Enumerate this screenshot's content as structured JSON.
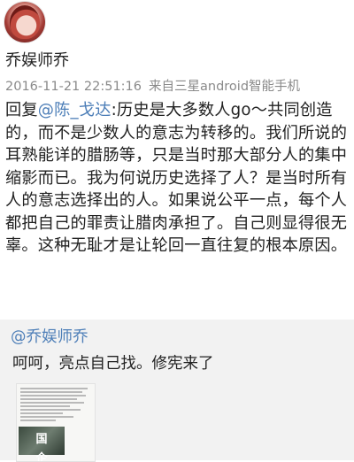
{
  "post": {
    "username": "乔娱师乔",
    "timestamp": "2016-11-21 22:51:16",
    "source": "来自三星android智能手机",
    "reply_prefix": "回复",
    "reply_mention": "@陈_戈达",
    "body": ":历史是大多数人go～共同创造的，而不是少数人的意志为转移的。我们所说的耳熟能详的腊肠等，只是当时那大部分人的集中缩影而已。我为何说历史选择了人？是当时所有人的意志选择出的人。如果说公平一点，每个人都把自己的罪责让腊肉承担了。自己则显得很无辜。这种无耻才是让轮回一直往复的根本原因。"
  },
  "retweet": {
    "mention": "@乔娱师乔",
    "text": "呵呵，亮点自己找。修宪来了",
    "thumbnail_caption": "国企"
  },
  "icons": {
    "avatar": "user-avatar"
  },
  "colors": {
    "mention": "#4e7fb8",
    "meta": "#8a8a8a",
    "retweet_bg": "#f2f2f2"
  }
}
